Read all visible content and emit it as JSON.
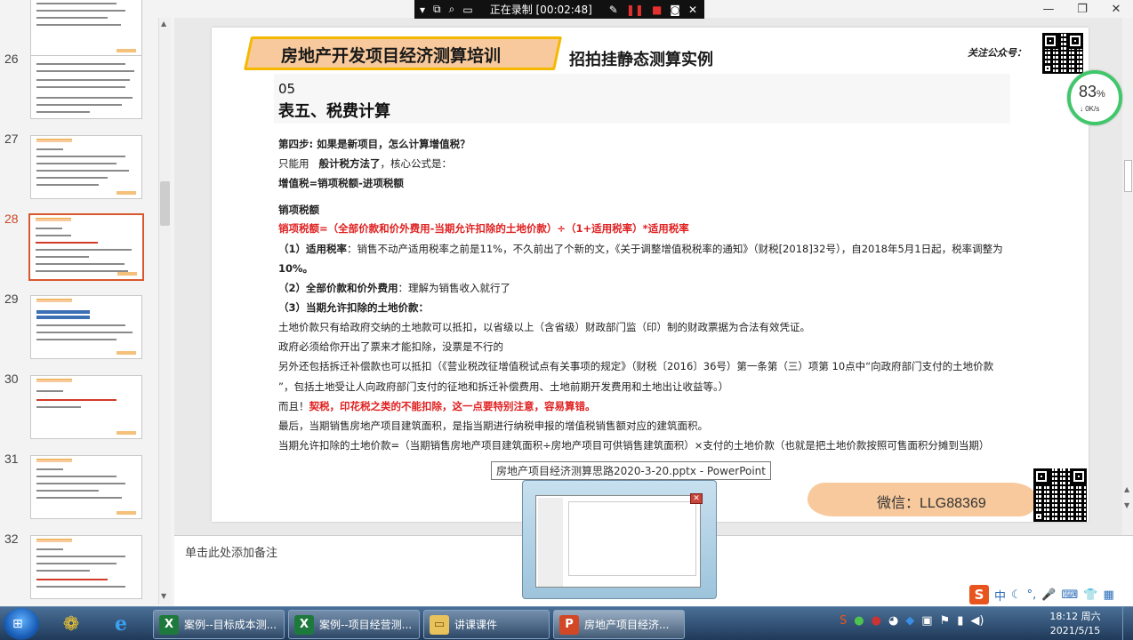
{
  "recorder": {
    "status_text": "正在录制 [00:02:48]"
  },
  "thumbnails": {
    "numbers": [
      "26",
      "27",
      "28",
      "29",
      "30",
      "31",
      "32"
    ],
    "active": "28"
  },
  "slide": {
    "title_banner": "房地产开发项目经济测算培训",
    "subtitle": "招拍挂静态测算实例",
    "follow_label": "关注公众号：",
    "section_number": "05",
    "section_title": "表五、税费计算",
    "lines": {
      "step4": "第四步: 如果是新项目，怎么计算增值税？",
      "only_use_a": "只能用",
      "only_use_b": "般计税方法了",
      "only_use_c": "，核心公式是：",
      "formula": "增值税=销项税额-进项税额",
      "output_tax_head": "销项税额",
      "output_tax_formula": "销项税额=（全部价款和价外费用-当期允许扣除的土地价款）÷（1+适用税率）*适用税率",
      "rate_label": "（1）适用税率",
      "rate_text": "：销售不动产适用税率之前是11%，不久前出了个新的文，《关于调整增值税税率的通知》（财税[2018]32号），自2018年5月1日起，税率调整为",
      "rate_value": "10%。",
      "all_price_label": "（2）全部价款和价外费用",
      "all_price_text": "：理解为销售收入就行了",
      "land_label": "（3）当期允许扣除的土地价款：",
      "land_1": "土地价款只有给政府交纳的土地款可以抵扣，以省级以上（含省级）财政部门监（印）制的财政票据为合法有效凭证。",
      "land_2": "政府必须给你开出了票来才能扣除，没票是不行的",
      "land_3": "另外还包括拆迁补偿款也可以抵扣（《营业税改征增值税试点有关事项的规定》（财税〔2016〕36号）第一条第（三）项第 10点中“向政府部门支付的土地价款",
      "land_4": "”，包括土地受让人向政府部门支付的征地和拆迁补偿费用、土地前期开发费用和土地出让收益等。）",
      "and_prefix": "而且！",
      "and_red": "契税，印花税之类的不能扣除，这一点要特别注意，容易算错。",
      "last_1": "最后，当期销售房地产项目建筑面积，是指当期进行纳税申报的增值税销售额对应的建筑面积。",
      "last_2": "当期允许扣除的土地价款=（当期销售房地产项目建筑面积÷房地产项目可供销售建筑面积）×支付的土地价款（也就是把土地价款按照可售面积分摊到当期）"
    },
    "wechat": "微信：LLG88369"
  },
  "speed_widget": {
    "percent": "83",
    "percent_unit": "%",
    "rate": "↓  0K/s"
  },
  "notes": {
    "placeholder": "单击此处添加备注"
  },
  "taskbar_preview": {
    "tooltip": "房地产项目经济测算思路2020-3-20.pptx - PowerPoint"
  },
  "sogou": {
    "logo": "S",
    "mode": "中"
  },
  "taskbar": {
    "buttons": [
      {
        "label": "案例--目标成本测...",
        "icon": "X"
      },
      {
        "label": "案例--项目经营测...",
        "icon": "X"
      },
      {
        "label": "讲课课件",
        "icon": "folder"
      },
      {
        "label": "房地产项目经济...",
        "icon": "P"
      }
    ],
    "clock_time": "18:12 周六",
    "clock_date": "2021/5/15"
  },
  "colors": {
    "banner_fill": "#f7c99c",
    "banner_border": "#f5b800",
    "highlight_red": "#e02020",
    "active_thumb": "#d9572f",
    "progress_ring": "#3fc76a"
  }
}
